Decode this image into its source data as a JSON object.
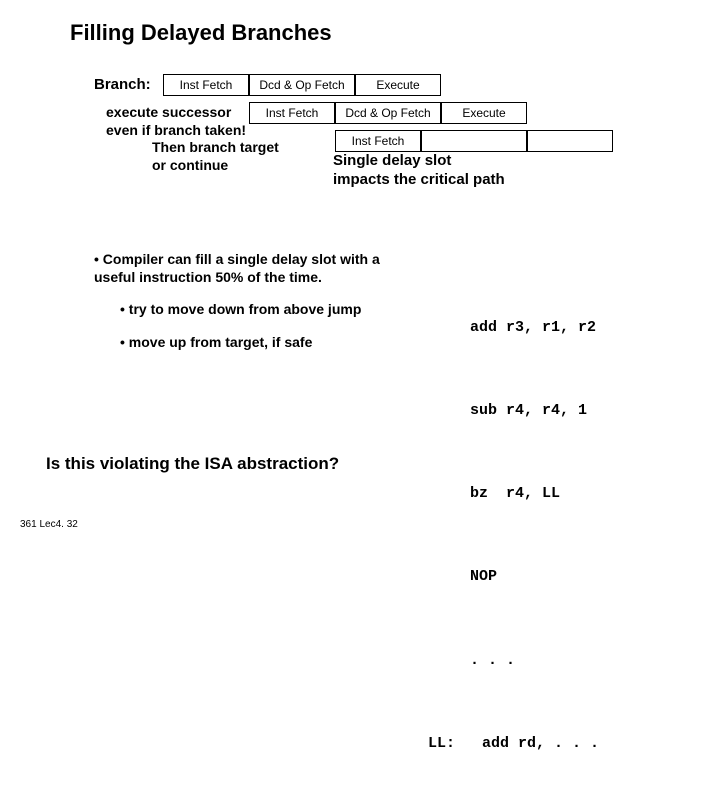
{
  "title": "Filling Delayed Branches",
  "branchLabel": "Branch:",
  "stages": {
    "if": "Inst Fetch",
    "dcd": "Dcd & Op Fetch",
    "ex": "Execute"
  },
  "successor": {
    "l1": "execute successor",
    "l2": "even if branch taken!",
    "l3": "Then branch target",
    "l4": "or continue"
  },
  "singleDelay": {
    "l1": "Single delay slot",
    "l2": "impacts the critical path"
  },
  "bullets": {
    "b1": "• Compiler can fill a single delay slot with a useful instruction 50% of the time.",
    "b2": "• try to move down from above jump",
    "b3": "• move up from target, if safe"
  },
  "code": {
    "c1": "add r3, r1, r2",
    "c2": "sub r4, r4, 1",
    "c3": "bz  r4, LL",
    "c4": "NOP",
    "c5": ". . .",
    "c6": "LL:   add rd, . . ."
  },
  "isaQuestion": "Is this violating the ISA abstraction?",
  "footer": "361  Lec4. 32"
}
